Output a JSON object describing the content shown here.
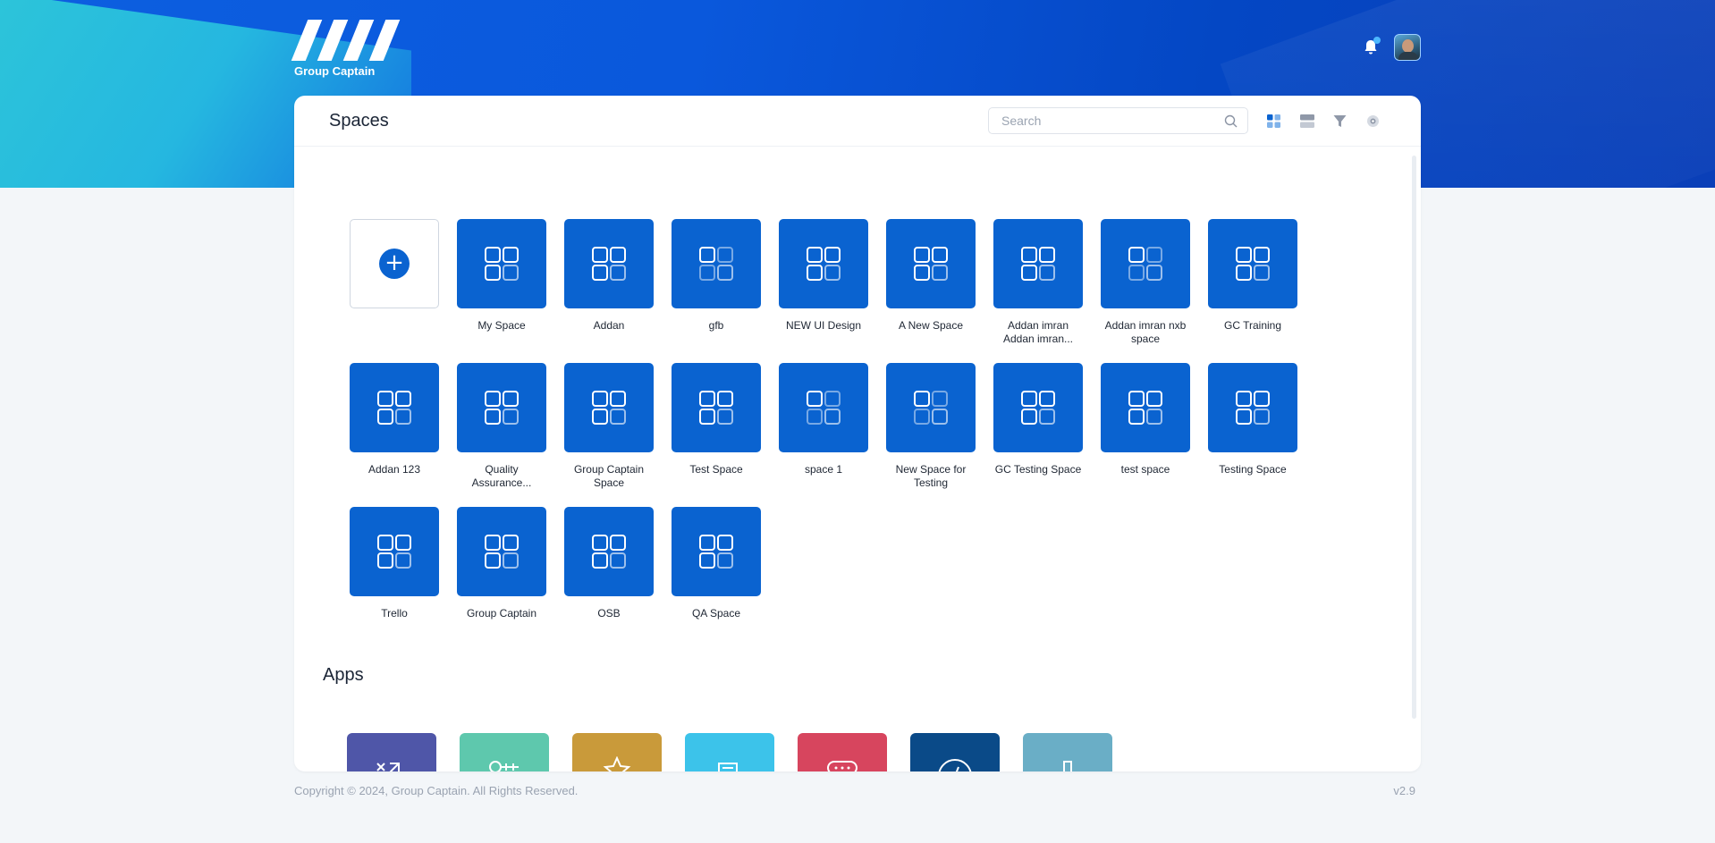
{
  "brand": {
    "name": "Group Captain"
  },
  "header": {
    "notification_icon": "bell-icon",
    "has_unread": true,
    "avatar_icon": "user-avatar"
  },
  "spaces_panel": {
    "title": "Spaces",
    "search": {
      "placeholder": "Search",
      "value": "",
      "icon": "search-icon"
    },
    "view_tools": [
      "grid-view-icon",
      "list-view-icon",
      "filter-icon",
      "settings-icon"
    ],
    "add_tile_icon": "plus-icon",
    "items": [
      {
        "label": "My Space",
        "pattern": "full"
      },
      {
        "label": "Addan",
        "pattern": "full"
      },
      {
        "label": "gfb",
        "pattern": "faded"
      },
      {
        "label": "NEW UI Design",
        "pattern": "full"
      },
      {
        "label": "A New Space",
        "pattern": "full"
      },
      {
        "label": "Addan imran Addan imran...",
        "pattern": "full"
      },
      {
        "label": "Addan imran nxb space",
        "pattern": "faded"
      },
      {
        "label": "GC Training",
        "pattern": "full"
      },
      {
        "label": "Addan 123",
        "pattern": "full"
      },
      {
        "label": "Quality Assurance...",
        "pattern": "full"
      },
      {
        "label": "Group Captain Space",
        "pattern": "full"
      },
      {
        "label": "Test Space",
        "pattern": "full"
      },
      {
        "label": "space 1",
        "pattern": "faded"
      },
      {
        "label": "New Space for Testing",
        "pattern": "faded"
      },
      {
        "label": "GC Testing Space",
        "pattern": "full"
      },
      {
        "label": "test space",
        "pattern": "full"
      },
      {
        "label": "Testing Space",
        "pattern": "full"
      },
      {
        "label": "Trello",
        "pattern": "full"
      },
      {
        "label": "Group Captain",
        "pattern": "full"
      },
      {
        "label": "OSB",
        "pattern": "full"
      },
      {
        "label": "QA Space",
        "pattern": "full"
      }
    ]
  },
  "apps_section": {
    "title": "Apps",
    "items": [
      {
        "icon": "workflow-icon",
        "color": "#4f56a8"
      },
      {
        "icon": "timeline-icon",
        "color": "#5ec8ad"
      },
      {
        "icon": "star-icon",
        "color": "#c99a3a"
      },
      {
        "icon": "document-icon",
        "color": "#3cc3ea"
      },
      {
        "icon": "chat-icon",
        "color": "#d7455e"
      },
      {
        "icon": "gauge-icon",
        "color": "#0a4a88"
      },
      {
        "icon": "device-icon",
        "color": "#6aaec6"
      }
    ]
  },
  "footer": {
    "copyright": "Copyright © 2024, Group Captain. All Rights Reserved.",
    "version": "v2.9"
  },
  "colors": {
    "primary": "#0a63d0",
    "background": "#f3f6f9"
  }
}
